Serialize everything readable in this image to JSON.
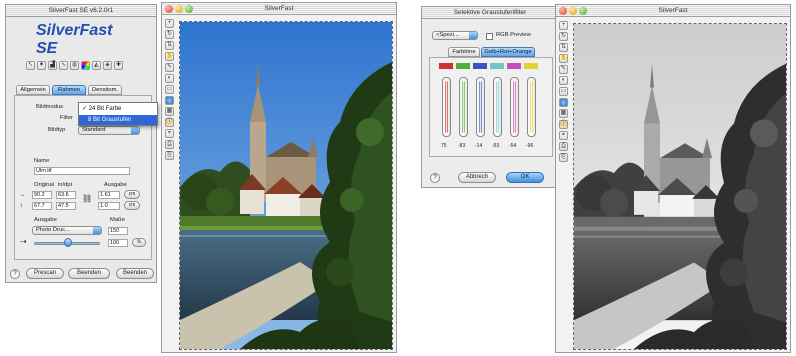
{
  "left_panel": {
    "title": "SilverFast SE v6.2.0r1",
    "brand": "SilverFast SE",
    "tabs": [
      "Allgemein",
      "Rahmen",
      "Densitom."
    ],
    "bildmodus_label": "Bildmodus",
    "filter_label": "Filter",
    "bildtyp_label": "Bildtyp",
    "bildtyp_value": "Standard",
    "name_label": "Name",
    "name_value": "Ulm.tif",
    "original_label": "Original",
    "ausgabe_label": "Ausgabe",
    "unit_label": "in/dpi",
    "orig_w": "90.2",
    "orig_h": "67.7",
    "orig_w2": "63.6",
    "orig_h2": "47.5",
    "out_w": "1.61",
    "out_h": "1.0",
    "cm_label": "cm",
    "scale_label": "Maße",
    "ausgabe2_label": "Ausgabe",
    "ausgabe_value": "Photo Druc...",
    "dpi_value": "150",
    "slider_value": "100",
    "percent_label": "%",
    "menu": [
      "24 Bit Farbe",
      "8 Bit Graustufen"
    ],
    "menu_checked": 0,
    "menu_highlighted": 1,
    "buttons": [
      "Prescan",
      "Beenden",
      "Beenden"
    ],
    "colors": {
      "brand": "#1f4fb3",
      "accent": "#3f8fe2"
    }
  },
  "preview_left": {
    "title": "SilverFast",
    "image": "color"
  },
  "selective_dialog": {
    "title": "Selektive Graustufenfilter",
    "preset_value": "<Spezi...",
    "checkbox_label": "RGB Preview",
    "tabs": [
      "Farbtöne",
      "Gelb+Rot+Orange"
    ],
    "tube_colors": [
      "#d03030",
      "#4cae3b",
      "#3a55c2",
      "#6fc7c9",
      "#c44fb8",
      "#e0d432"
    ],
    "tube_values": [
      "75",
      "-83",
      "-14",
      "-53",
      "-54",
      "-96"
    ],
    "buttons": [
      "Abbrech",
      "OK"
    ]
  },
  "preview_right": {
    "title": "SilverFast",
    "image": "grayscale"
  }
}
